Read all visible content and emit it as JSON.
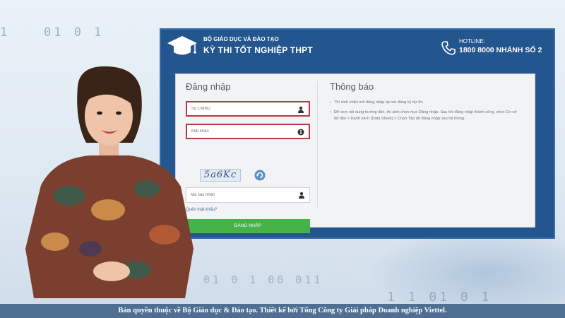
{
  "background_digits": {
    "top_left": "01 0 1",
    "top_left_edge": "1",
    "bottom_center": "01 0 1 00 011",
    "bottom_right": "1 1   01 0 1"
  },
  "header": {
    "org_name": "BỘ GIÁO DỤC VÀ ĐÀO TẠO",
    "exam_title": "KỲ THI TỐT NGHIỆP THPT",
    "hotline_label": "HOTLINE:",
    "hotline_number": "1800 8000 NHÁNH SỐ 2",
    "logo_icon": "graduation-cap-icon",
    "phone_icon": "phone-icon",
    "color": "#23558e"
  },
  "login": {
    "title": "Đăng nhập",
    "username_placeholder": "Số CMND",
    "password_placeholder": "Mật khẩu",
    "captcha_text": "5a6Kc",
    "captcha_placeholder": "Mã xác nhận",
    "forgot_link": "Quên mật khẩu?",
    "submit_label": "ĐĂNG NHẬP",
    "error_border_color": "#b53a45",
    "button_color": "#43b34a"
  },
  "notice": {
    "title": "Thông báo",
    "items": [
      "Thí sinh nhận mã đăng nhập tại nơi đăng ký dự thi.",
      "Để xem nội dung hướng dẫn, thí sinh chọn mục Đăng nhập. Sau khi đăng nhập thành công, chọn Cơ sở dữ liệu > Danh sách (Data Sheet) > Chọn Tệp để đăng nhập vào hệ thống."
    ]
  },
  "footer": {
    "text": "Bản quyền thuộc về Bộ Giáo dục & Đào tạo. Thiết kế bởi Tổng Công ty Giải pháp Doanh nghiệp Viettel."
  }
}
